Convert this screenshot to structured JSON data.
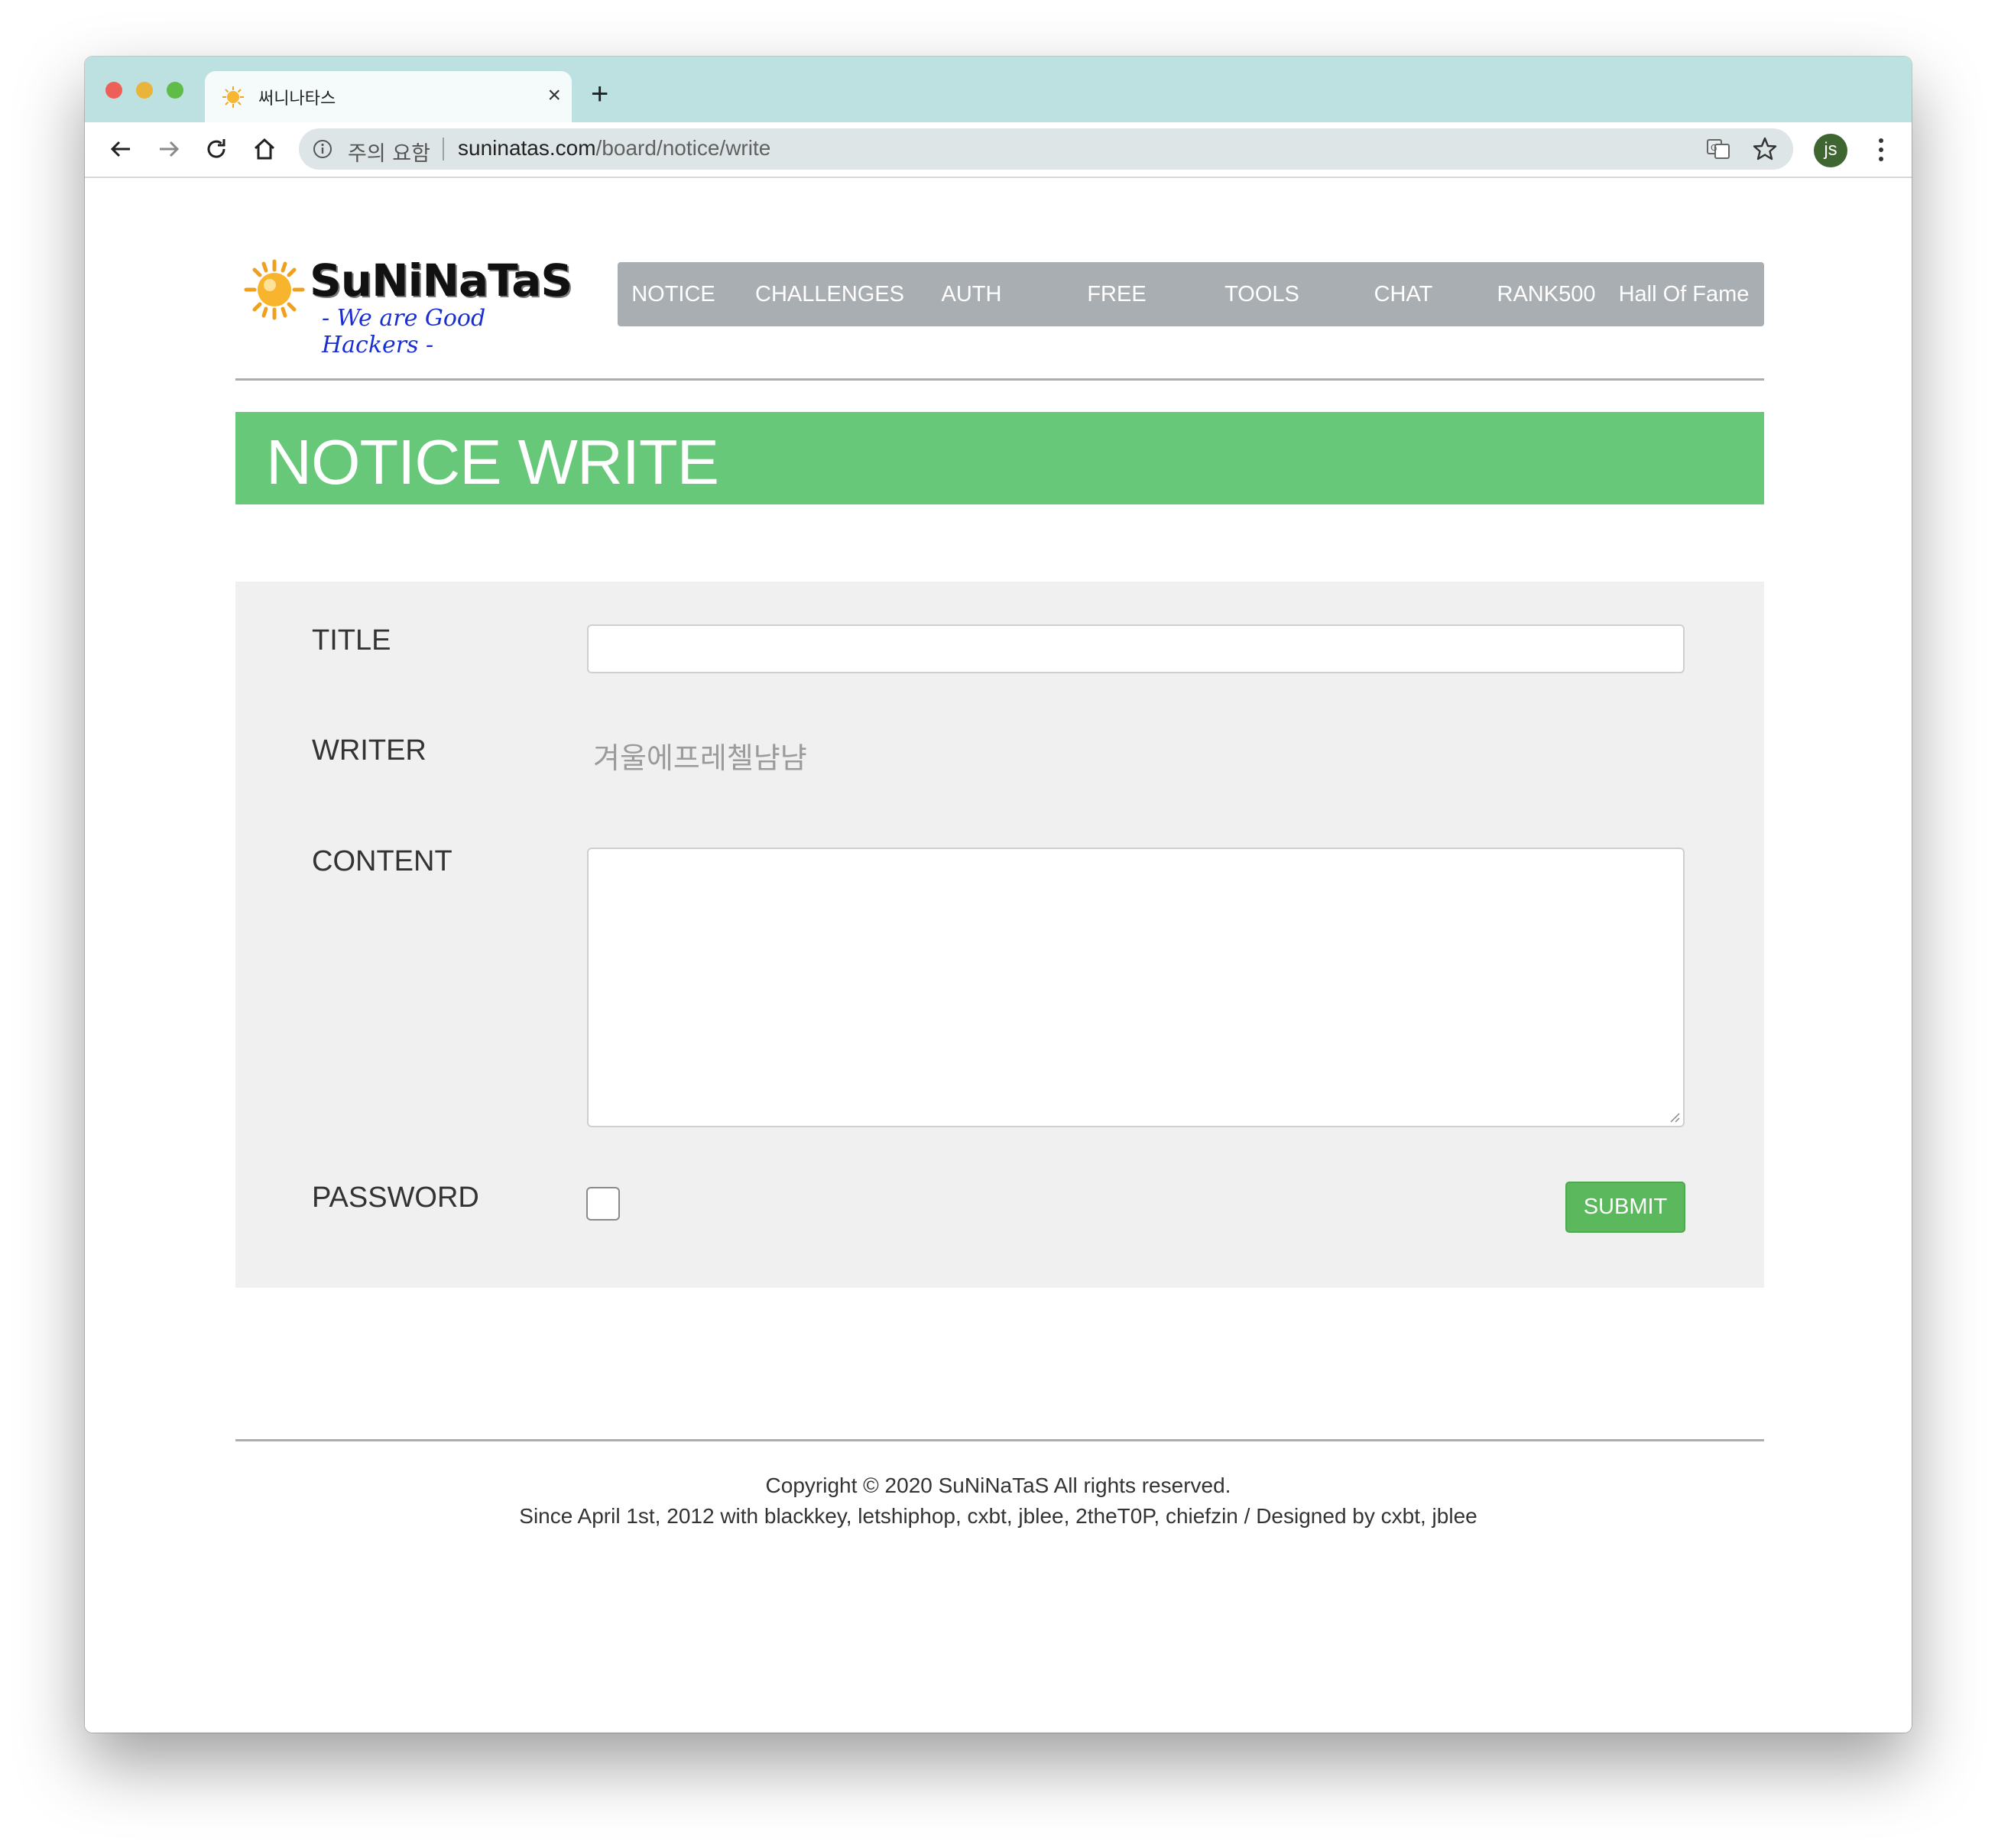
{
  "browser": {
    "tab_title": "써니나타스",
    "tab_close": "×",
    "new_tab": "+",
    "security_label": "주의 요함",
    "url_domain": "suninatas.com",
    "url_path": "/board/notice/write",
    "avatar_initials": "js"
  },
  "site": {
    "logo_title": "SuNiNaTaS",
    "logo_tagline": "- We are Good Hackers -",
    "nav": [
      "NOTICE",
      "CHALLENGES",
      "AUTH",
      "FREE",
      "TOOLS",
      "CHAT",
      "RANK500",
      "Hall Of Fame"
    ]
  },
  "page": {
    "banner_title": "NOTICE WRITE"
  },
  "form": {
    "title_label": "TITLE",
    "title_value": "",
    "writer_label": "WRITER",
    "writer_value": "겨울에프레첼냠냠",
    "content_label": "CONTENT",
    "content_value": "",
    "password_label": "PASSWORD",
    "password_checked": false,
    "submit_label": "SUBMIT"
  },
  "footer": {
    "line1": "Copyright © 2020 SuNiNaTaS All rights reserved.",
    "line2": "Since April 1st, 2012 with blackkey, letshiphop, cxbt, jblee, 2theT0P, chiefzin / Designed by cxbt, jblee"
  },
  "colors": {
    "titlebar": "#bde0e1",
    "navbar": "#a9aeb2",
    "banner": "#67c879",
    "submit": "#5cb85c",
    "form_panel": "#f0f0f0"
  }
}
